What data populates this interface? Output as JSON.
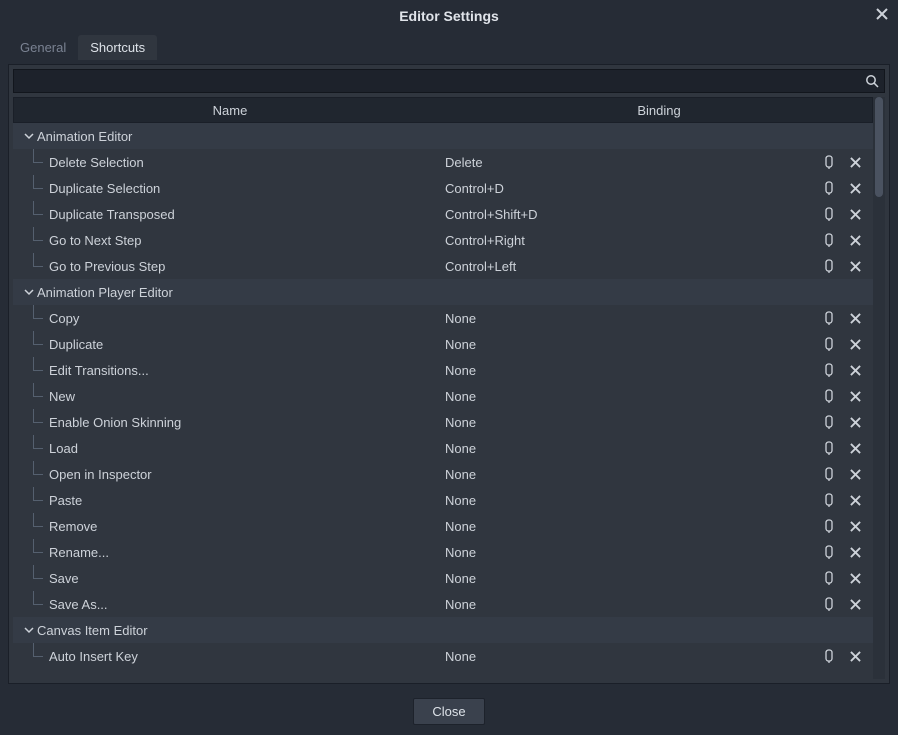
{
  "dialog": {
    "title": "Editor Settings",
    "close_button": "Close"
  },
  "tabs": {
    "general": "General",
    "shortcuts": "Shortcuts"
  },
  "search": {
    "value": ""
  },
  "columns": {
    "name": "Name",
    "binding": "Binding"
  },
  "groups": [
    {
      "label": "Animation Editor",
      "items": [
        {
          "name": "Delete Selection",
          "binding": "Delete"
        },
        {
          "name": "Duplicate Selection",
          "binding": "Control+D"
        },
        {
          "name": "Duplicate Transposed",
          "binding": "Control+Shift+D"
        },
        {
          "name": "Go to Next Step",
          "binding": "Control+Right"
        },
        {
          "name": "Go to Previous Step",
          "binding": "Control+Left"
        }
      ]
    },
    {
      "label": "Animation Player Editor",
      "items": [
        {
          "name": "Copy",
          "binding": "None"
        },
        {
          "name": "Duplicate",
          "binding": "None"
        },
        {
          "name": "Edit Transitions...",
          "binding": "None"
        },
        {
          "name": "New",
          "binding": "None"
        },
        {
          "name": "Enable Onion Skinning",
          "binding": "None"
        },
        {
          "name": "Load",
          "binding": "None"
        },
        {
          "name": "Open in Inspector",
          "binding": "None"
        },
        {
          "name": "Paste",
          "binding": "None"
        },
        {
          "name": "Remove",
          "binding": "None"
        },
        {
          "name": "Rename...",
          "binding": "None"
        },
        {
          "name": "Save",
          "binding": "None"
        },
        {
          "name": "Save As...",
          "binding": "None"
        }
      ]
    },
    {
      "label": "Canvas Item Editor",
      "items": [
        {
          "name": "Auto Insert Key",
          "binding": "None"
        }
      ]
    }
  ]
}
